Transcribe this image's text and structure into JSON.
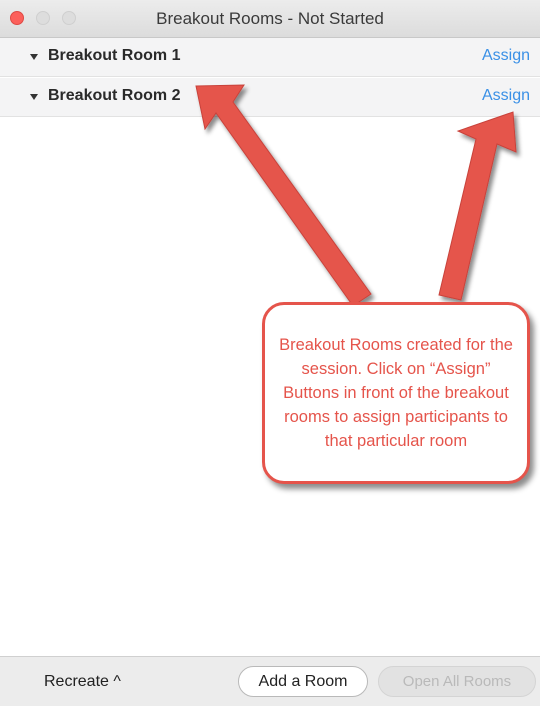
{
  "window": {
    "title": "Breakout Rooms - Not Started"
  },
  "rooms": [
    {
      "name": "Breakout Room 1",
      "action": "Assign"
    },
    {
      "name": "Breakout Room 2",
      "action": "Assign"
    }
  ],
  "annotation": {
    "text": "Breakout Rooms created for the session. Click on “Assign” Buttons in front of the breakout rooms to assign participants to that particular room",
    "color": "#e5544b"
  },
  "footer": {
    "recreate_label": "Recreate ^",
    "add_room_label": "Add a Room",
    "open_all_label": "Open All Rooms"
  },
  "colors": {
    "link": "#3a90e6",
    "close_button": "#fc605b"
  }
}
